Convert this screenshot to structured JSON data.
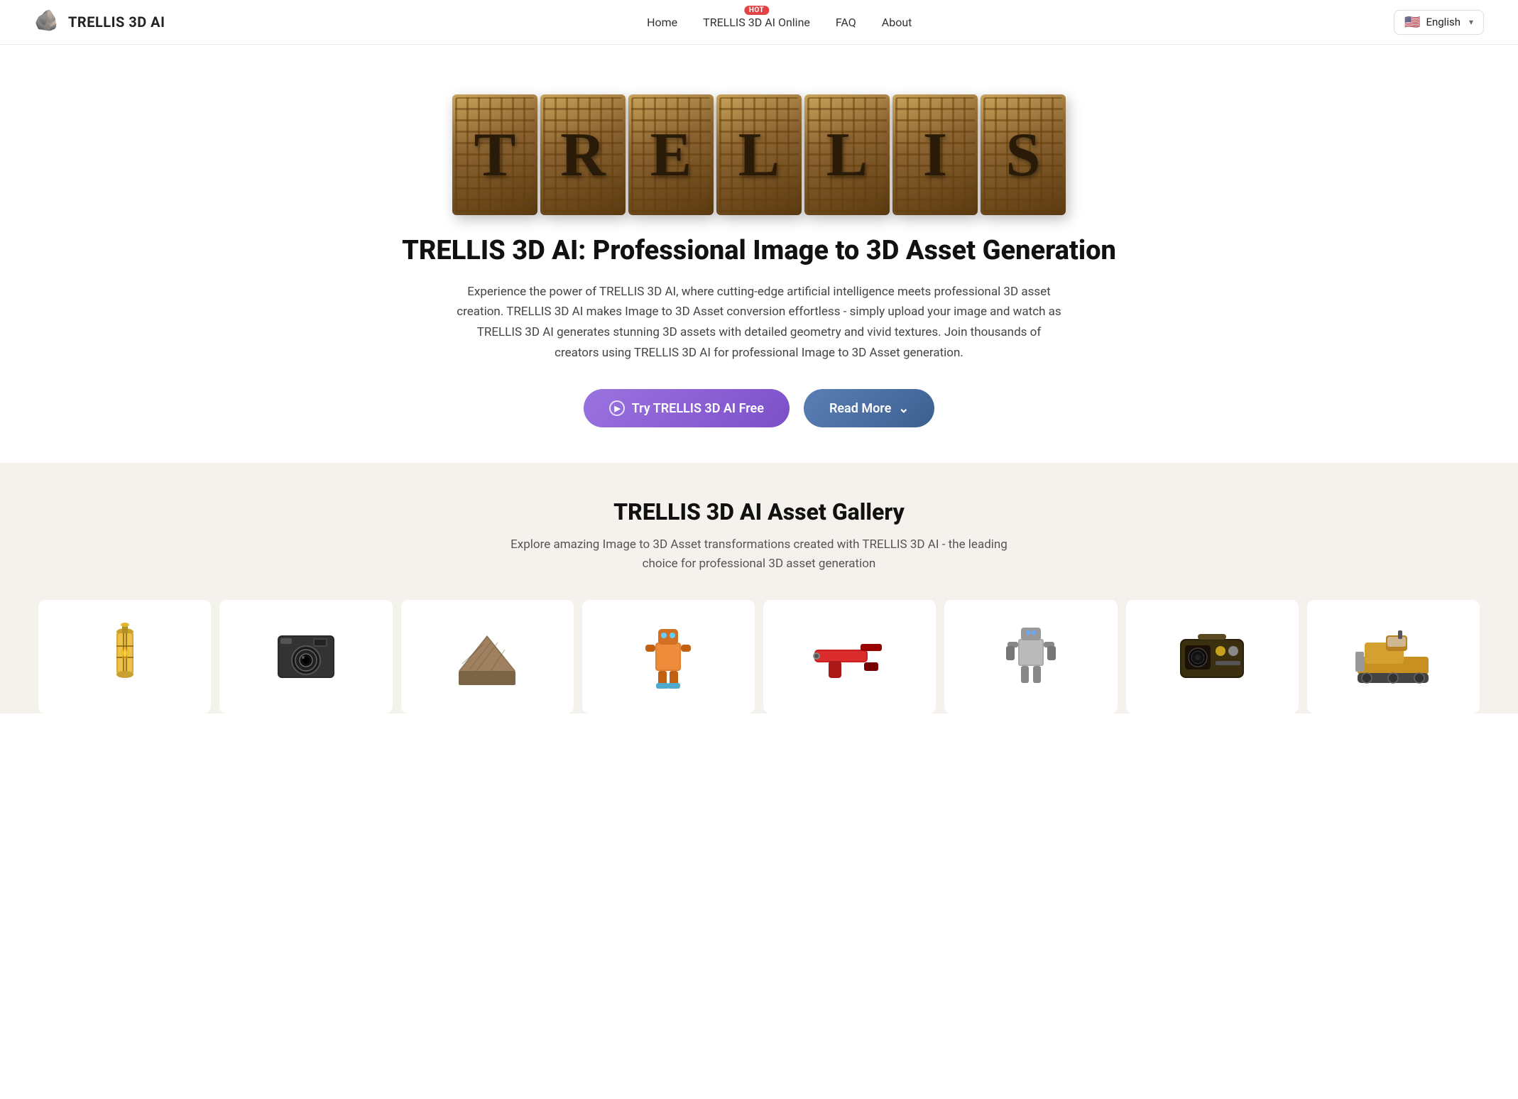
{
  "nav": {
    "logo_icon": "🪨",
    "logo_text": "TRELLIS 3D AI",
    "links": [
      {
        "label": "Home",
        "href": "#",
        "hot": false
      },
      {
        "label": "TRELLIS 3D AI Online",
        "href": "#",
        "hot": true
      },
      {
        "label": "FAQ",
        "href": "#",
        "hot": false
      },
      {
        "label": "About",
        "href": "#",
        "hot": false
      }
    ],
    "lang_flag": "🇺🇸",
    "lang_label": "English"
  },
  "hero": {
    "letters": [
      "T",
      "R",
      "E",
      "L",
      "L",
      "I",
      "S"
    ],
    "heading": "TRELLIS 3D AI: Professional Image to 3D Asset Generation",
    "description": "Experience the power of TRELLIS 3D AI, where cutting-edge artificial intelligence meets professional 3D asset creation. TRELLIS 3D AI makes Image to 3D Asset conversion effortless - simply upload your image and watch as TRELLIS 3D AI generates stunning 3D assets with detailed geometry and vivid textures. Join thousands of creators using TRELLIS 3D AI for professional Image to 3D Asset generation.",
    "btn_primary": "Try TRELLIS 3D AI Free",
    "btn_secondary": "Read More"
  },
  "gallery": {
    "heading": "TRELLIS 3D AI Asset Gallery",
    "description": "Explore amazing Image to 3D Asset transformations created with TRELLIS 3D AI - the leading choice for professional 3D asset generation",
    "items": [
      {
        "label": "Lantern",
        "emoji": "🏮"
      },
      {
        "label": "Camera",
        "emoji": "📷"
      },
      {
        "label": "Roof",
        "emoji": "🏠"
      },
      {
        "label": "Robot",
        "emoji": "🤖"
      },
      {
        "label": "Gun",
        "emoji": "🔫"
      },
      {
        "label": "Mech",
        "emoji": "🦾"
      },
      {
        "label": "Radio",
        "emoji": "📻"
      },
      {
        "label": "Bulldozer",
        "emoji": "🚜"
      }
    ]
  }
}
